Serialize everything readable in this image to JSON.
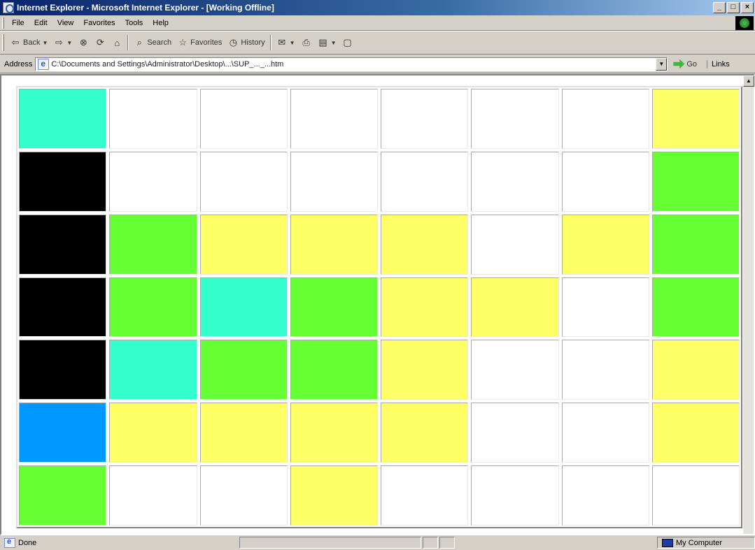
{
  "window": {
    "title": "Internet Explorer - Microsoft Internet Explorer - [Working Offline]",
    "buttons": [
      "_",
      "□",
      "×"
    ]
  },
  "menubar": {
    "items": [
      "File",
      "Edit",
      "View",
      "Favorites",
      "Tools",
      "Help"
    ]
  },
  "toolbar": {
    "back": "Back",
    "search": "Search",
    "favorites": "Favorites",
    "history": "History"
  },
  "addressbar": {
    "label": "Address",
    "url": "C:\\Documents and Settings\\Administrator\\Desktop\\...\\SUP_..._...htm",
    "go": "Go",
    "links": "Links"
  },
  "grid": {
    "colors": {
      "W": "#ffffff",
      "K": "#000000",
      "C": "#33ffcc",
      "G": "#66ff33",
      "Y": "#ffff66",
      "B": "#0099ff"
    },
    "rows": [
      [
        "C",
        "W",
        "W",
        "W",
        "W",
        "W",
        "W",
        "Y"
      ],
      [
        "K",
        "W",
        "W",
        "W",
        "W",
        "W",
        "W",
        "G"
      ],
      [
        "K",
        "G",
        "Y",
        "Y",
        "Y",
        "W",
        "Y",
        "G"
      ],
      [
        "K",
        "G",
        "C",
        "G",
        "Y",
        "Y",
        "W",
        "G"
      ],
      [
        "K",
        "C",
        "G",
        "G",
        "Y",
        "W",
        "W",
        "Y"
      ],
      [
        "B",
        "Y",
        "Y",
        "Y",
        "Y",
        "W",
        "W",
        "Y"
      ],
      [
        "G",
        "W",
        "W",
        "Y",
        "W",
        "W",
        "W",
        "W"
      ]
    ]
  },
  "statusbar": {
    "text": "Done",
    "zone": "My Computer"
  }
}
